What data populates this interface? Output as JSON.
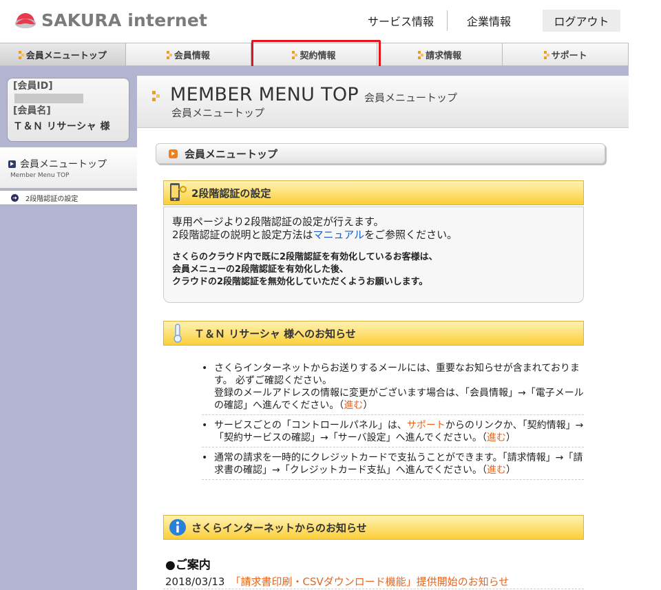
{
  "header": {
    "logo_text": "SAKURA internet",
    "links": [
      "サービス情報",
      "企業情報"
    ],
    "logout_label": "ログアウト"
  },
  "nav": {
    "tabs": [
      "会員メニュートップ",
      "会員情報",
      "契約情報",
      "請求情報",
      "サポート"
    ],
    "active_index": 0,
    "highlighted_index": 2
  },
  "sidebar": {
    "member_id_label": "[会員ID]",
    "member_name_label": "[会員名]",
    "member_name": "Ｔ＆Ｎ リサーシャ 様",
    "menu_title": "会員メニュートップ",
    "menu_subtitle": "Member Menu TOP",
    "items": [
      "2段階認証の設定"
    ]
  },
  "page": {
    "title_en": "MEMBER MENU TOP",
    "title_jp_small": "会員メニュートップ",
    "title_jp": "会員メニュートップ",
    "breadcrumb": "会員メニュートップ"
  },
  "auth": {
    "heading": "2段階認証の設定",
    "line1": "専用ページより2段階認証の設定が行えます。",
    "line2_pre": "2段階認証の説明と設定方法は",
    "line2_link": "マニュアル",
    "line2_post": "をご参照ください。",
    "bold1": "さくらのクラウド内で既に2段階認証を有効化しているお客様は、",
    "bold2": "会員メニューの2段階認証を有効化した後、",
    "bold3": "クラウドの2段階認証を無効化していただくようお願いします。"
  },
  "notices": {
    "heading": "Ｔ＆Ｎ リサーシャ 様へのお知らせ",
    "item1_a": "さくらインターネットからお送りするメールには、重要なお知らせが含まれております。 必ずご確認ください。",
    "item1_b": "登録のメールアドレスの情報に変更がございます場合は、「会員情報」→「電子メールの確認」へ進んでください。（",
    "item1_link": "進む",
    "item1_end": "）",
    "item2_a": "サービスごとの「コントロールパネル」は、",
    "item2_link1": "サポート",
    "item2_b": "からのリンクか、「契約情報」→「契約サービスの確認」→「サーバ設定」へ進んでください。（",
    "item2_link2": "進む",
    "item2_end": "）",
    "item3_a": "通常の請求を一時的にクレジットカードで支払うことができます。「請求情報」→「請求書の確認」→「クレジットカード支払」へ進んでください。（",
    "item3_link": "進む",
    "item3_end": "）"
  },
  "news": {
    "heading": "さくらインターネットからのお知らせ",
    "guide_title": "●ご案内",
    "date": "2018/03/13",
    "link": "「請求書印刷・CSVダウンロード機能」提供開始のお知らせ"
  },
  "colors": {
    "accent_orange": "#e8641b",
    "sidebar_bg": "#b2b4d0",
    "section_yellow": "#fbcf3a",
    "highlight_red": "#e3141b",
    "link_blue": "#1a5fbf"
  }
}
